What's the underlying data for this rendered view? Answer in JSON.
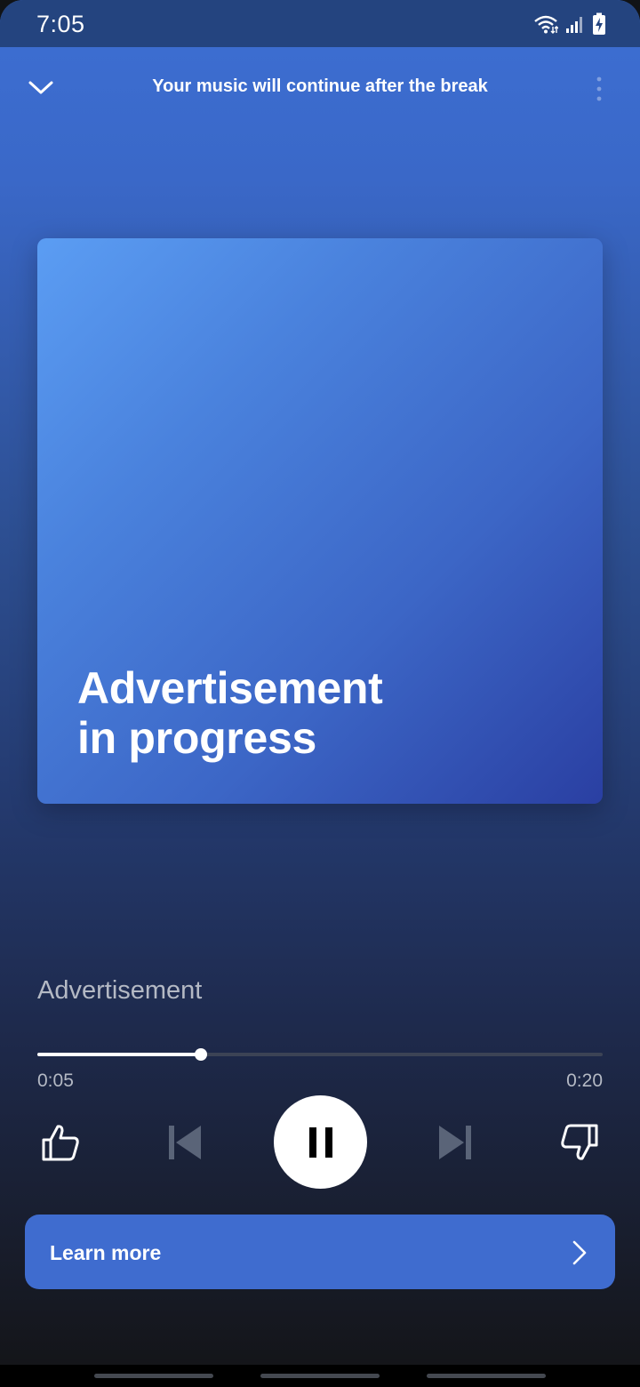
{
  "status_bar": {
    "time": "7:05",
    "icons": [
      "wifi-icon",
      "signal-icon",
      "battery-charging-icon"
    ]
  },
  "header": {
    "title": "Your music will continue after the break",
    "collapse_icon": "chevron-down-icon",
    "menu_icon": "more-vertical-icon"
  },
  "artwork": {
    "line1": "Advertisement",
    "line2": "in progress"
  },
  "track": {
    "title": "Advertisement"
  },
  "playback": {
    "elapsed": "0:05",
    "duration": "0:20",
    "progress_fraction": 0.29
  },
  "controls": {
    "like_icon": "thumbs-up-icon",
    "previous_icon": "skip-previous-icon",
    "pause_icon": "pause-icon",
    "next_icon": "skip-next-icon",
    "dislike_icon": "thumbs-down-icon"
  },
  "cta": {
    "label": "Learn more",
    "arrow_icon": "chevron-right-icon"
  },
  "colors": {
    "accent": "#3f6ccf",
    "status_bar": "#24447f",
    "disabled_control": "#5a6478"
  }
}
